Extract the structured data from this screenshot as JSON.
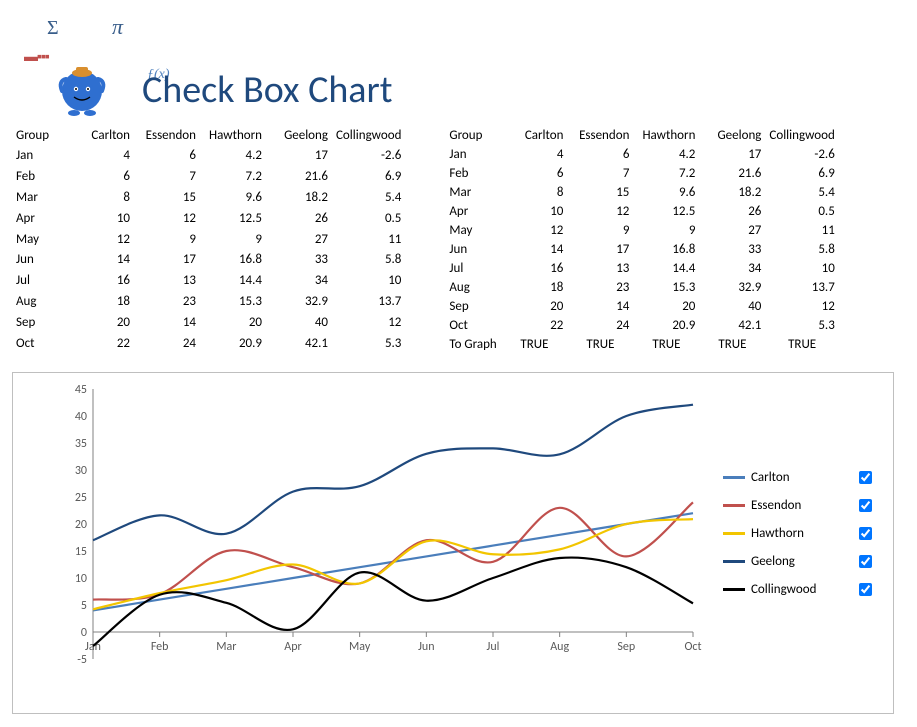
{
  "title": "Check Box Chart",
  "decor": {
    "sigma": "Σ",
    "pi": "π",
    "fx": "ƒ(x)"
  },
  "columns": [
    "Group",
    "Carlton",
    "Essendon",
    "Hawthorn",
    "Geelong",
    "Collingwood"
  ],
  "months": [
    "Jan",
    "Feb",
    "Mar",
    "Apr",
    "May",
    "Jun",
    "Jul",
    "Aug",
    "Sep",
    "Oct"
  ],
  "to_graph_label": "To Graph",
  "to_graph": [
    "TRUE",
    "TRUE",
    "TRUE",
    "TRUE",
    "TRUE"
  ],
  "series": [
    {
      "name": "Carlton",
      "color": "#4a7ebb",
      "values": [
        4,
        6,
        8,
        10,
        12,
        14,
        16,
        18,
        20,
        22
      ]
    },
    {
      "name": "Essendon",
      "color": "#c0504d",
      "values": [
        6,
        7,
        15,
        12,
        9,
        17,
        13,
        23,
        14,
        24
      ]
    },
    {
      "name": "Hawthorn",
      "color": "#f2c500",
      "values": [
        4.2,
        7.2,
        9.6,
        12.5,
        9,
        16.8,
        14.4,
        15.3,
        20,
        20.9
      ]
    },
    {
      "name": "Geelong",
      "color": "#1f497d",
      "values": [
        17,
        21.6,
        18.2,
        26,
        27,
        33,
        34,
        32.9,
        40,
        42.1
      ]
    },
    {
      "name": "Collingwood",
      "color": "#000000",
      "values": [
        -2.6,
        6.9,
        5.4,
        0.5,
        11,
        5.8,
        10,
        13.7,
        12,
        5.3
      ]
    }
  ],
  "chart_data": {
    "type": "line",
    "title": "",
    "xlabel": "",
    "ylabel": "",
    "ylim": [
      -5,
      45
    ],
    "categories": [
      "Jan",
      "Feb",
      "Mar",
      "Apr",
      "May",
      "Jun",
      "Jul",
      "Aug",
      "Sep",
      "Oct"
    ],
    "series": [
      {
        "name": "Carlton",
        "values": [
          4,
          6,
          8,
          10,
          12,
          14,
          16,
          18,
          20,
          22
        ]
      },
      {
        "name": "Essendon",
        "values": [
          6,
          7,
          15,
          12,
          9,
          17,
          13,
          23,
          14,
          24
        ]
      },
      {
        "name": "Hawthorn",
        "values": [
          4.2,
          7.2,
          9.6,
          12.5,
          9,
          16.8,
          14.4,
          15.3,
          20,
          20.9
        ]
      },
      {
        "name": "Geelong",
        "values": [
          17,
          21.6,
          18.2,
          26,
          27,
          33,
          34,
          32.9,
          40,
          42.1
        ]
      },
      {
        "name": "Collingwood",
        "values": [
          -2.6,
          6.9,
          5.4,
          0.5,
          11,
          5.8,
          10,
          13.7,
          12,
          5.3
        ]
      }
    ],
    "legend_position": "right",
    "grid": false
  }
}
